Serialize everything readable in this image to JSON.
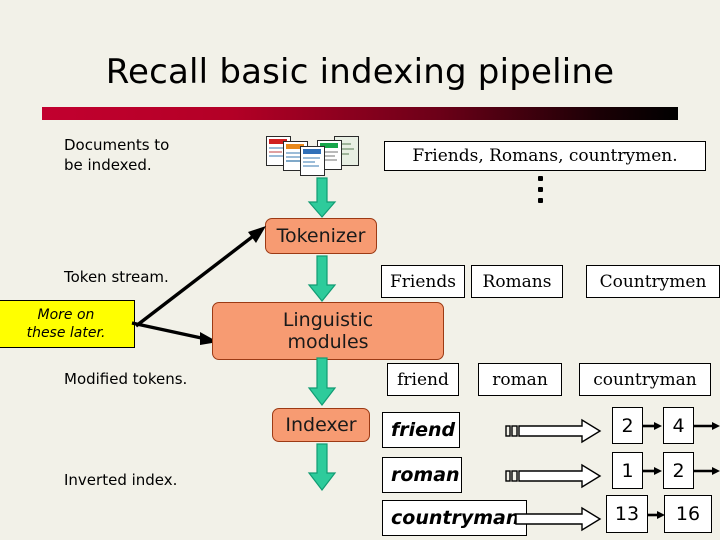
{
  "slide": {
    "title": "Recall basic indexing pipeline",
    "accent_bar_start": "#c2002f",
    "accent_bar_end": "#000000",
    "background": "#f2f1e8"
  },
  "captions": {
    "documents": "Documents to\nbe indexed.",
    "token_stream": "Token stream.",
    "modified_tokens": "Modified tokens.",
    "inverted_index": "Inverted index."
  },
  "callout": {
    "text": "More on\nthese later.",
    "fill": "#ffff00"
  },
  "stages": [
    {
      "id": "tokenizer",
      "label": "Tokenizer",
      "fill": "#f79b72"
    },
    {
      "id": "linguistic-modules",
      "label": "Linguistic\nmodules",
      "fill": "#f79b72"
    },
    {
      "id": "indexer",
      "label": "Indexer",
      "fill": "#f79b72"
    }
  ],
  "arrow_color": "#2ecb9b",
  "document_sample": {
    "text": "Friends, Romans, countrymen.",
    "ellipsis": "⋮"
  },
  "token_stream_boxes": [
    "Friends",
    "Romans",
    "Countrymen"
  ],
  "modified_token_boxes": [
    "friend",
    "roman",
    "countryman"
  ],
  "inverted_index": {
    "entries": [
      {
        "term": "friend",
        "postings": [
          "2",
          "4"
        ],
        "continues": true
      },
      {
        "term": "roman",
        "postings": [
          "1",
          "2"
        ],
        "continues": true
      },
      {
        "term": "countryman",
        "postings": [
          "13",
          "16"
        ],
        "continues": false
      }
    ]
  },
  "icons": {
    "document_stack": "document-stack-icon",
    "posting_arrow": "hollow-right-arrow-icon",
    "flow_arrow": "green-down-arrow-icon",
    "vertical_ellipsis": "vertical-ellipsis-icon"
  }
}
